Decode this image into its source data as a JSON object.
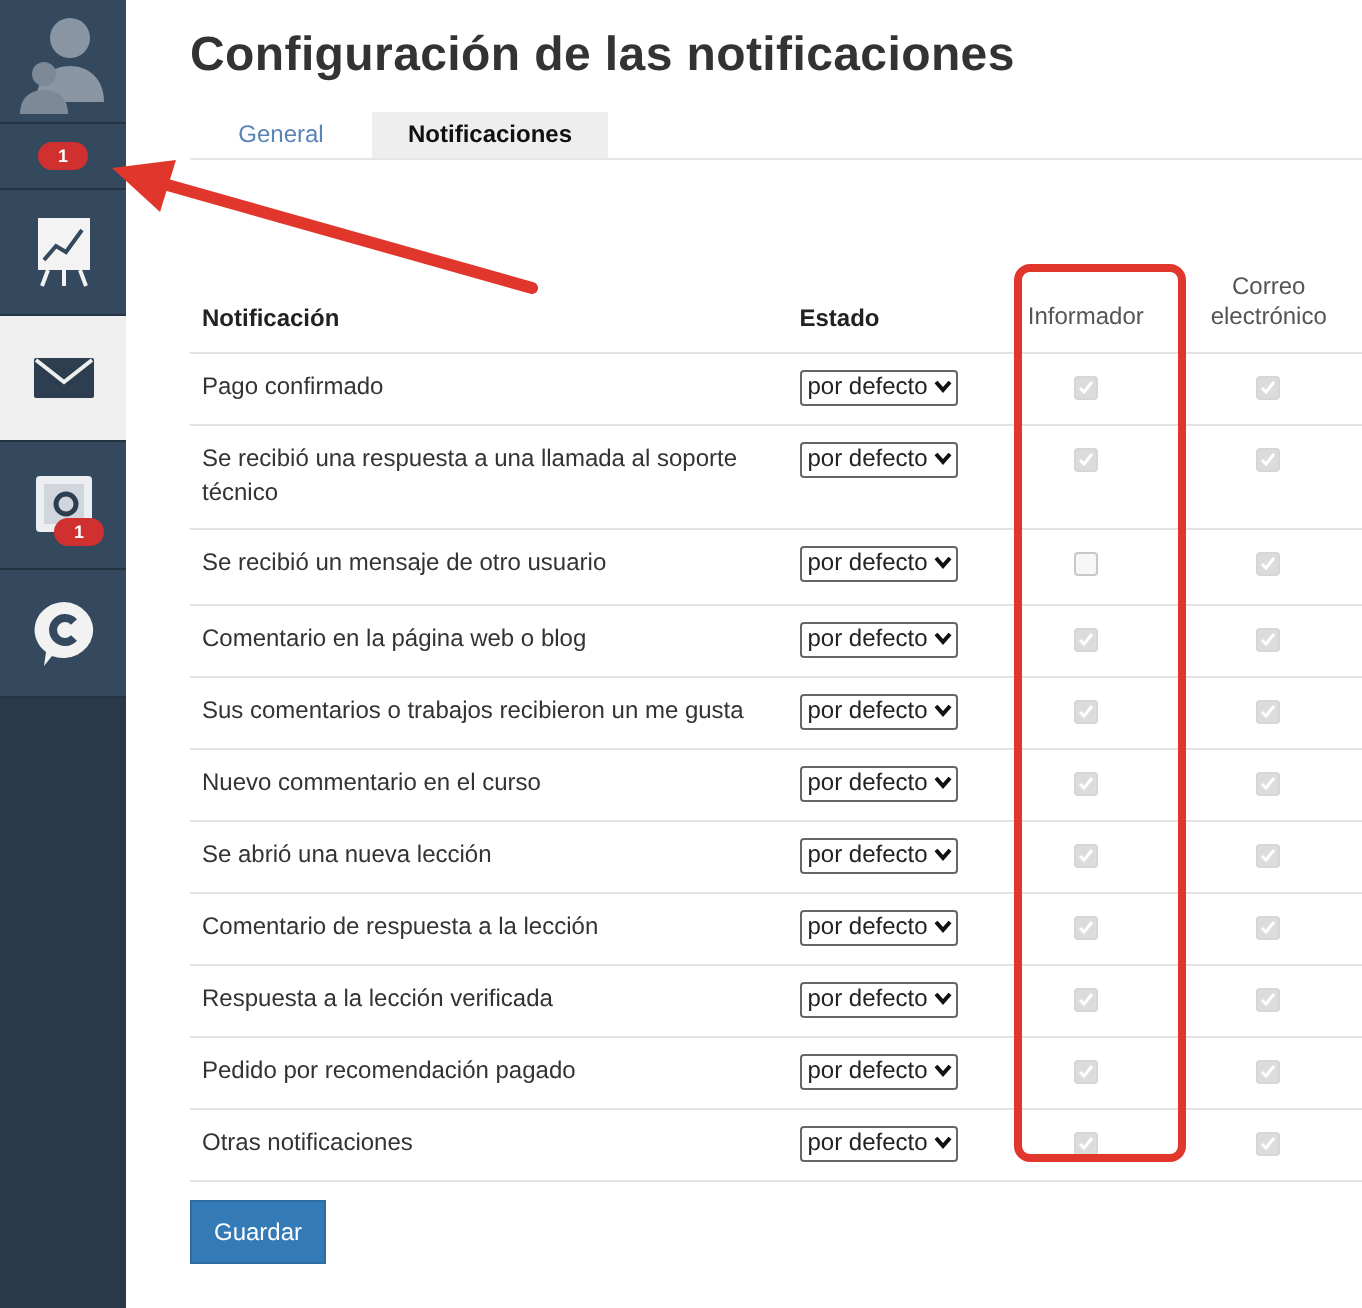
{
  "sidebar": {
    "items": [
      {
        "kind": "avatar",
        "selected": false
      },
      {
        "kind": "badge",
        "badge": "1",
        "selected": false
      },
      {
        "kind": "chart",
        "selected": false
      },
      {
        "kind": "mail",
        "selected": true
      },
      {
        "kind": "safe",
        "badge": "1",
        "selected": false
      },
      {
        "kind": "chat",
        "selected": false
      }
    ]
  },
  "title": "Configuración de las notificaciones",
  "tabs": [
    {
      "label": "General",
      "selected": false
    },
    {
      "label": "Notificaciones",
      "selected": true
    }
  ],
  "table": {
    "columns": [
      "Notificación",
      "Estado",
      "Informador",
      "Correo electrónico"
    ],
    "rows": [
      {
        "name": "Pago confirmado",
        "state": "por defecto",
        "informer": true,
        "email": true
      },
      {
        "name": "Se recibió una respuesta a una llamada al soporte técnico",
        "state": "por defecto",
        "informer": true,
        "email": true
      },
      {
        "name": "Se recibió un mensaje de otro usuario",
        "state": "por defecto",
        "informer": false,
        "email": true
      },
      {
        "name": "Comentario en la página web o blog",
        "state": "por defecto",
        "informer": true,
        "email": true
      },
      {
        "name": "Sus comentarios o trabajos recibieron un me gusta",
        "state": "por defecto",
        "informer": true,
        "email": true
      },
      {
        "name": "Nuevo commentario en el curso",
        "state": "por defecto",
        "informer": true,
        "email": true
      },
      {
        "name": "Se abrió una nueva lección",
        "state": "por defecto",
        "informer": true,
        "email": true
      },
      {
        "name": "Comentario de respuesta a la lección",
        "state": "por defecto",
        "informer": true,
        "email": true
      },
      {
        "name": "Respuesta a la lección verificada",
        "state": "por defecto",
        "informer": true,
        "email": true
      },
      {
        "name": "Pedido por recomendación pagado",
        "state": "por defecto",
        "informer": true,
        "email": true
      },
      {
        "name": "Otras notificaciones",
        "state": "por defecto",
        "informer": true,
        "email": true
      }
    ]
  },
  "save_button": "Guardar",
  "annotations": {
    "arrow": true,
    "column_frame": true
  }
}
